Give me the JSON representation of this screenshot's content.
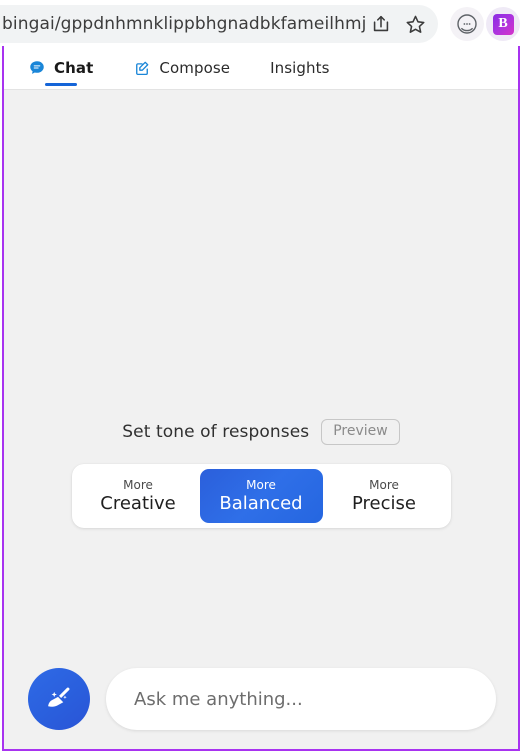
{
  "browser": {
    "url": "bingai/gppdnhmnklippbhgnadbkfameilhmj...",
    "share_icon": "share-icon",
    "bookmark_icon": "star-icon",
    "extension_icon": "chat-circle-icon",
    "bing_badge_label": "B"
  },
  "tabs": [
    {
      "label": "Chat",
      "icon": "chat-bubble-icon",
      "active": true
    },
    {
      "label": "Compose",
      "icon": "compose-pencil-icon",
      "active": false
    },
    {
      "label": "Insights",
      "icon": "",
      "active": false
    }
  ],
  "tone": {
    "heading": "Set tone of responses",
    "preview_label": "Preview",
    "prefix": "More",
    "options": [
      {
        "name": "Creative",
        "selected": false
      },
      {
        "name": "Balanced",
        "selected": true
      },
      {
        "name": "Precise",
        "selected": false
      }
    ]
  },
  "composer": {
    "new_topic_icon": "broom-icon",
    "placeholder": "Ask me anything...",
    "value": ""
  },
  "colors": {
    "accent_blue": "#2f6fe8",
    "tab_underline": "#1565d8",
    "panel_outline": "#a833f0",
    "content_bg": "#f1f1f1"
  }
}
